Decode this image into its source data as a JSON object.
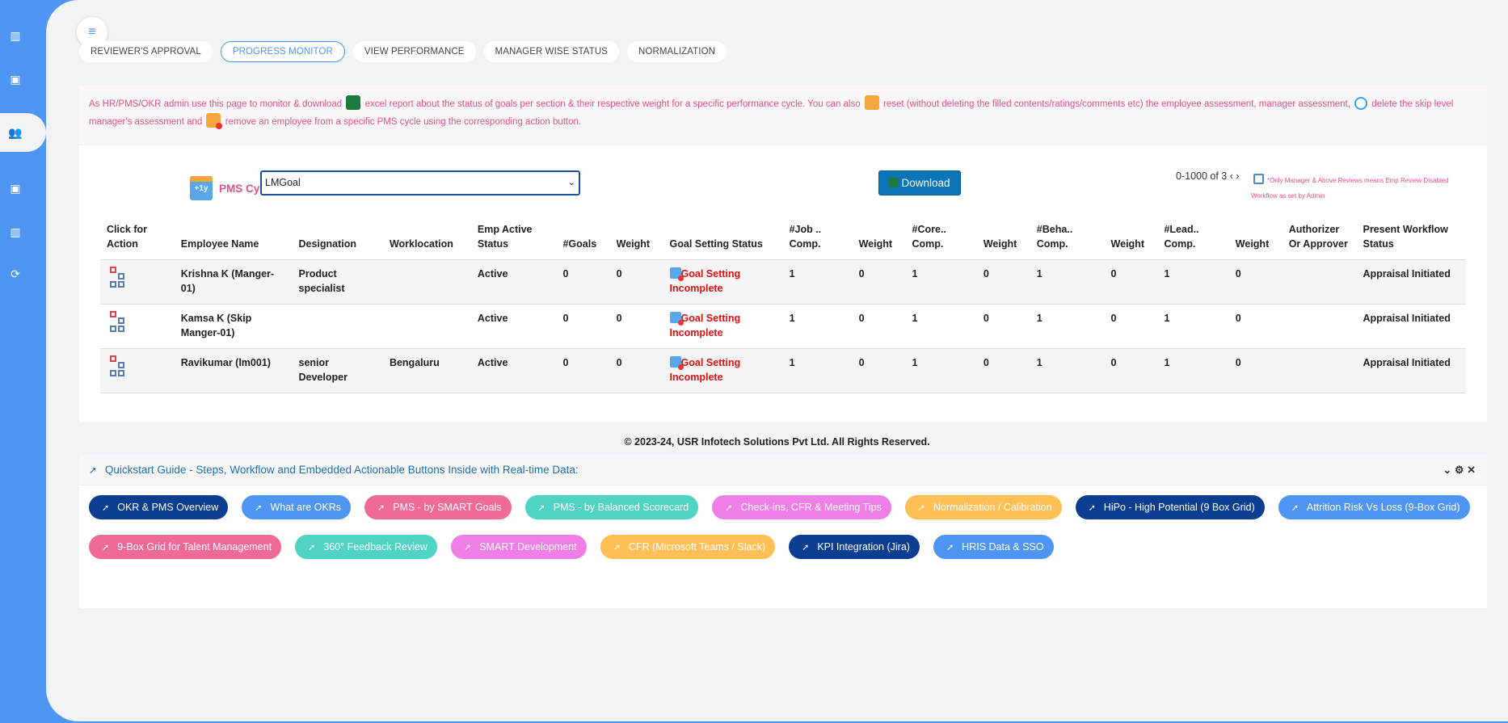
{
  "tabs": [
    "REVIEWER'S APPROVAL",
    "PROGRESS MONITOR",
    "VIEW PERFORMANCE",
    "MANAGER WISE STATUS",
    "NORMALIZATION"
  ],
  "active_tab": "PROGRESS MONITOR",
  "info": {
    "part1": "As HR/PMS/OKR admin use this page to monitor & download",
    "part2": "excel report about the status of goals per section & their respective weight for a specific performance cycle. You can also",
    "part3": "reset (without deleting the filled contents/ratings/comments etc) the employee assessment, manager assessment,",
    "part4": "delete the skip level manager's assessment and",
    "part5": "remove an employee from a specific PMS cycle using the corresponding action button."
  },
  "pms": {
    "icon_text": "+1y",
    "label": "PMS Cycle",
    "selected": "LMGoal",
    "download_label": "Download",
    "pager": "0-1000 of 3 ‹ ›",
    "note": "*Only Manager & Above Reviews means Emp Review Disabled Workflow as set by Admin"
  },
  "table": {
    "headers": [
      "Click for Action",
      "Employee Name",
      "Designation",
      "Worklocation",
      "Emp Active Status",
      "#Goals",
      "Weight",
      "Goal Setting Status",
      "#Job .. Comp.",
      "Weight",
      "#Core.. Comp.",
      "Weight",
      "#Beha.. Comp.",
      "Weight",
      "#Lead.. Comp.",
      "Weight",
      "Authorizer Or Approver",
      "Present Workflow Status"
    ],
    "rows": [
      [
        "",
        "Krishna K (Manger-01)",
        "Product specialist",
        "",
        "Active",
        "0",
        "0",
        "Goal Setting Incomplete",
        "1",
        "0",
        "1",
        "0",
        "1",
        "0",
        "1",
        "0",
        "",
        "Appraisal Initiated"
      ],
      [
        "",
        "Kamsa K (Skip Manger-01)",
        "",
        "",
        "Active",
        "0",
        "0",
        "Goal Setting Incomplete",
        "1",
        "0",
        "1",
        "0",
        "1",
        "0",
        "1",
        "0",
        "",
        "Appraisal Initiated"
      ],
      [
        "",
        "Ravikumar (lm001)",
        "senior Developer",
        "Bengaluru",
        "Active",
        "0",
        "0",
        "Goal Setting Incomplete",
        "1",
        "0",
        "1",
        "0",
        "1",
        "0",
        "1",
        "0",
        "",
        "Appraisal Initiated"
      ]
    ]
  },
  "footer": "© 2023-24, USR Infotech Solutions Pvt Ltd. All Rights Reserved.",
  "guide": {
    "title": "Quickstart Guide - Steps, Workflow and Embedded Actionable Buttons Inside with Real-time Data:",
    "controls": "⌄ ⚙ ✕",
    "pills": [
      {
        "label": "OKR & PMS Overview",
        "color": "#0b3d91"
      },
      {
        "label": "What are OKRs",
        "color": "#4f95f3"
      },
      {
        "label": "PMS - by SMART Goals",
        "color": "#f06a96"
      },
      {
        "label": "PMS - by Balanced Scorecard",
        "color": "#4fd3c4"
      },
      {
        "label": "Check-ins, CFR & Meeting Tips",
        "color": "#ef7ee6"
      },
      {
        "label": "Normalization / Calibration",
        "color": "#ffbf55"
      },
      {
        "label": "HiPo - High Potential (9 Box Grid)",
        "color": "#0b3d91"
      },
      {
        "label": "Attrition Risk Vs Loss (9-Box Grid)",
        "color": "#4f95f3"
      },
      {
        "label": "9-Box Grid for Talent Management",
        "color": "#f06a96"
      },
      {
        "label": "360° Feedback Review",
        "color": "#4fd3c4"
      },
      {
        "label": "SMART Development",
        "color": "#ef7ee6"
      },
      {
        "label": "CFR (Microsoft Teams / Slack)",
        "color": "#ffbf55"
      },
      {
        "label": "KPI Integration (Jira)",
        "color": "#0b3d91"
      },
      {
        "label": "HRIS Data & SSO",
        "color": "#4f95f3"
      }
    ]
  },
  "icons": {
    "sidebar": [
      "chart-icon",
      "board-icon",
      "users-icon",
      "board-icon",
      "chart-icon",
      "sync-icon"
    ],
    "toggle": "menu-collapse-icon"
  }
}
